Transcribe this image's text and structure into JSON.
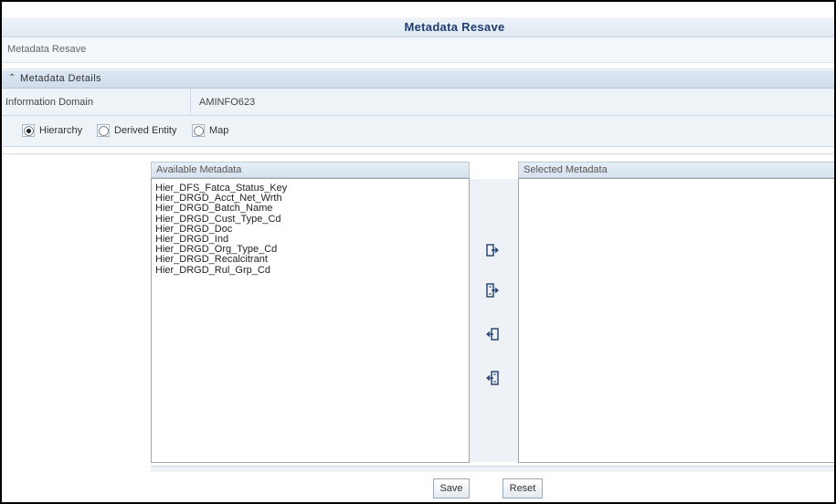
{
  "title": "Metadata Resave",
  "breadcrumb": "Metadata Resave",
  "section": {
    "label": "Metadata Details",
    "collapse_icon": "double-chevron-up-icon"
  },
  "info_domain": {
    "label": "Information Domain",
    "value": "AMINFO623"
  },
  "metadata_type": {
    "selected": "Hierarchy",
    "options": [
      "Hierarchy",
      "Derived Entity",
      "Map"
    ]
  },
  "available": {
    "header": "Available Metadata",
    "items": [
      "Hier_DFS_Fatca_Status_Key",
      "Hier_DRGD_Acct_Net_Wrth",
      "Hier_DRGD_Batch_Name",
      "Hier_DRGD_Cust_Type_Cd",
      "Hier_DRGD_Doc",
      "Hier_DRGD_Ind",
      "Hier_DRGD_Org_Type_Cd",
      "Hier_DRGD_Recalcitrant",
      "Hier_DRGD_Rul_Grp_Cd"
    ]
  },
  "selected": {
    "header": "Selected Metadata",
    "items": []
  },
  "move_buttons": [
    "move-selected-right-icon",
    "move-all-right-icon",
    "move-selected-left-icon",
    "move-all-left-icon"
  ],
  "actions": {
    "save": "Save",
    "reset": "Reset"
  }
}
